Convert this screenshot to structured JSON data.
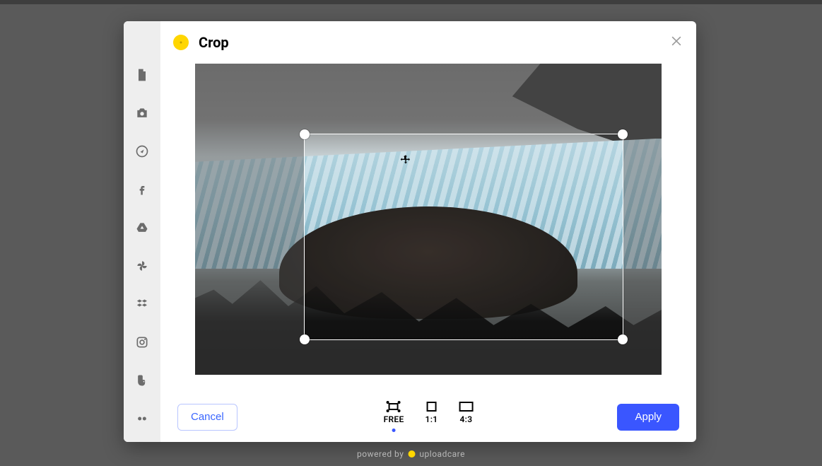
{
  "header": {
    "title": "Crop"
  },
  "sidebar": {
    "items": [
      {
        "name": "file"
      },
      {
        "name": "camera"
      },
      {
        "name": "link"
      },
      {
        "name": "facebook"
      },
      {
        "name": "gdrive"
      },
      {
        "name": "gphotos"
      },
      {
        "name": "dropbox"
      },
      {
        "name": "instagram"
      },
      {
        "name": "evernote"
      },
      {
        "name": "flickr"
      }
    ]
  },
  "ratios": {
    "free": "FREE",
    "square": "1:1",
    "four_three": "4:3",
    "active": "free"
  },
  "actions": {
    "cancel": "Cancel",
    "apply": "Apply"
  },
  "footer": {
    "powered_prefix": "powered by",
    "powered_brand": "uploadcare"
  }
}
